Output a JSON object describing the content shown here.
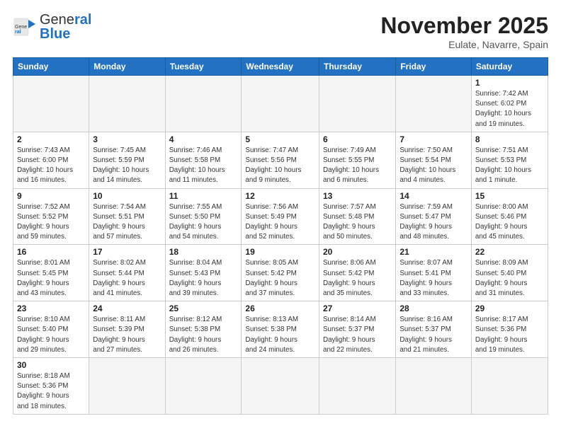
{
  "header": {
    "logo_general": "General",
    "logo_blue": "Blue",
    "month_title": "November 2025",
    "location": "Eulate, Navarre, Spain"
  },
  "weekdays": [
    "Sunday",
    "Monday",
    "Tuesday",
    "Wednesday",
    "Thursday",
    "Friday",
    "Saturday"
  ],
  "weeks": [
    [
      {
        "day": "",
        "info": ""
      },
      {
        "day": "",
        "info": ""
      },
      {
        "day": "",
        "info": ""
      },
      {
        "day": "",
        "info": ""
      },
      {
        "day": "",
        "info": ""
      },
      {
        "day": "",
        "info": ""
      },
      {
        "day": "1",
        "info": "Sunrise: 7:42 AM\nSunset: 6:02 PM\nDaylight: 10 hours\nand 19 minutes."
      }
    ],
    [
      {
        "day": "2",
        "info": "Sunrise: 7:43 AM\nSunset: 6:00 PM\nDaylight: 10 hours\nand 16 minutes."
      },
      {
        "day": "3",
        "info": "Sunrise: 7:45 AM\nSunset: 5:59 PM\nDaylight: 10 hours\nand 14 minutes."
      },
      {
        "day": "4",
        "info": "Sunrise: 7:46 AM\nSunset: 5:58 PM\nDaylight: 10 hours\nand 11 minutes."
      },
      {
        "day": "5",
        "info": "Sunrise: 7:47 AM\nSunset: 5:56 PM\nDaylight: 10 hours\nand 9 minutes."
      },
      {
        "day": "6",
        "info": "Sunrise: 7:49 AM\nSunset: 5:55 PM\nDaylight: 10 hours\nand 6 minutes."
      },
      {
        "day": "7",
        "info": "Sunrise: 7:50 AM\nSunset: 5:54 PM\nDaylight: 10 hours\nand 4 minutes."
      },
      {
        "day": "8",
        "info": "Sunrise: 7:51 AM\nSunset: 5:53 PM\nDaylight: 10 hours\nand 1 minute."
      }
    ],
    [
      {
        "day": "9",
        "info": "Sunrise: 7:52 AM\nSunset: 5:52 PM\nDaylight: 9 hours\nand 59 minutes."
      },
      {
        "day": "10",
        "info": "Sunrise: 7:54 AM\nSunset: 5:51 PM\nDaylight: 9 hours\nand 57 minutes."
      },
      {
        "day": "11",
        "info": "Sunrise: 7:55 AM\nSunset: 5:50 PM\nDaylight: 9 hours\nand 54 minutes."
      },
      {
        "day": "12",
        "info": "Sunrise: 7:56 AM\nSunset: 5:49 PM\nDaylight: 9 hours\nand 52 minutes."
      },
      {
        "day": "13",
        "info": "Sunrise: 7:57 AM\nSunset: 5:48 PM\nDaylight: 9 hours\nand 50 minutes."
      },
      {
        "day": "14",
        "info": "Sunrise: 7:59 AM\nSunset: 5:47 PM\nDaylight: 9 hours\nand 48 minutes."
      },
      {
        "day": "15",
        "info": "Sunrise: 8:00 AM\nSunset: 5:46 PM\nDaylight: 9 hours\nand 45 minutes."
      }
    ],
    [
      {
        "day": "16",
        "info": "Sunrise: 8:01 AM\nSunset: 5:45 PM\nDaylight: 9 hours\nand 43 minutes."
      },
      {
        "day": "17",
        "info": "Sunrise: 8:02 AM\nSunset: 5:44 PM\nDaylight: 9 hours\nand 41 minutes."
      },
      {
        "day": "18",
        "info": "Sunrise: 8:04 AM\nSunset: 5:43 PM\nDaylight: 9 hours\nand 39 minutes."
      },
      {
        "day": "19",
        "info": "Sunrise: 8:05 AM\nSunset: 5:42 PM\nDaylight: 9 hours\nand 37 minutes."
      },
      {
        "day": "20",
        "info": "Sunrise: 8:06 AM\nSunset: 5:42 PM\nDaylight: 9 hours\nand 35 minutes."
      },
      {
        "day": "21",
        "info": "Sunrise: 8:07 AM\nSunset: 5:41 PM\nDaylight: 9 hours\nand 33 minutes."
      },
      {
        "day": "22",
        "info": "Sunrise: 8:09 AM\nSunset: 5:40 PM\nDaylight: 9 hours\nand 31 minutes."
      }
    ],
    [
      {
        "day": "23",
        "info": "Sunrise: 8:10 AM\nSunset: 5:40 PM\nDaylight: 9 hours\nand 29 minutes."
      },
      {
        "day": "24",
        "info": "Sunrise: 8:11 AM\nSunset: 5:39 PM\nDaylight: 9 hours\nand 27 minutes."
      },
      {
        "day": "25",
        "info": "Sunrise: 8:12 AM\nSunset: 5:38 PM\nDaylight: 9 hours\nand 26 minutes."
      },
      {
        "day": "26",
        "info": "Sunrise: 8:13 AM\nSunset: 5:38 PM\nDaylight: 9 hours\nand 24 minutes."
      },
      {
        "day": "27",
        "info": "Sunrise: 8:14 AM\nSunset: 5:37 PM\nDaylight: 9 hours\nand 22 minutes."
      },
      {
        "day": "28",
        "info": "Sunrise: 8:16 AM\nSunset: 5:37 PM\nDaylight: 9 hours\nand 21 minutes."
      },
      {
        "day": "29",
        "info": "Sunrise: 8:17 AM\nSunset: 5:36 PM\nDaylight: 9 hours\nand 19 minutes."
      }
    ],
    [
      {
        "day": "30",
        "info": "Sunrise: 8:18 AM\nSunset: 5:36 PM\nDaylight: 9 hours\nand 18 minutes."
      },
      {
        "day": "",
        "info": ""
      },
      {
        "day": "",
        "info": ""
      },
      {
        "day": "",
        "info": ""
      },
      {
        "day": "",
        "info": ""
      },
      {
        "day": "",
        "info": ""
      },
      {
        "day": "",
        "info": ""
      }
    ]
  ]
}
